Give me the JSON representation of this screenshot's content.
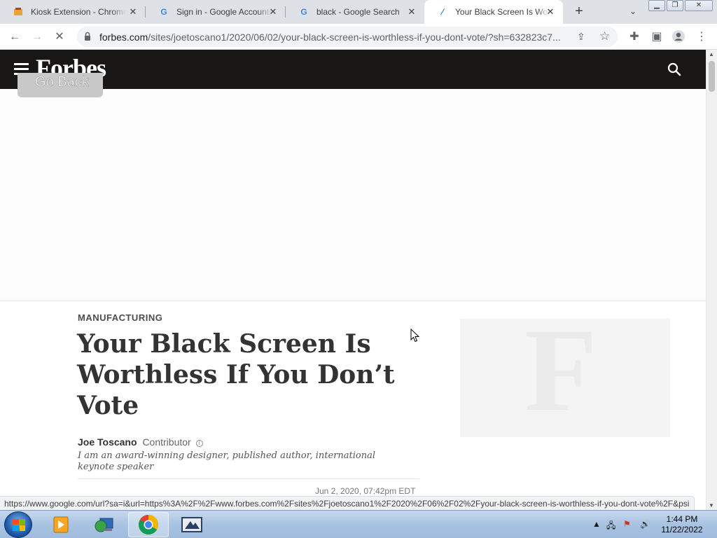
{
  "browser": {
    "tabs": [
      {
        "title": "Kiosk Extension - Chrome",
        "favicon": "kiosk-favicon",
        "active": false
      },
      {
        "title": "Sign in - Google Accounts",
        "favicon": "google-favicon",
        "active": false
      },
      {
        "title": "black - Google Search",
        "favicon": "google-favicon",
        "active": false
      },
      {
        "title": "Your Black Screen Is Worthless",
        "favicon": "forbes-favicon",
        "active": true
      }
    ],
    "new_tab_symbol": "+",
    "url_host": "forbes.com",
    "url_path": "/sites/joetoscano1/2020/06/02/your-black-screen-is-worthless-if-you-dont-vote/?sh=632823c7...",
    "status_url": "https://www.google.com/url?sa=i&url=https%3A%2F%2Fwww.forbes.com%2Fsites%2Fjoetoscano1%2F2020%2F06%2F02%2Fyour-black-screen-is-worthless-if-you-dont-vote%2F&psi..."
  },
  "page": {
    "logo": "Forbes",
    "go_back": "Go Back",
    "category": "MANUFACTURING",
    "headline": "Your Black Screen Is Worthless If You Don’t Vote",
    "author_name": "Joe Toscano",
    "author_role": "Contributor",
    "bio": "I am an award-winning designer, published author, international keynote speaker",
    "date": "Jun 2, 2020, 07:42pm EDT",
    "placeholder_letter": "F"
  },
  "taskbar": {
    "apps": [
      "media-player",
      "network-app",
      "chrome",
      "remote-desktop"
    ],
    "time": "1:44 PM",
    "date": "11/22/2022"
  },
  "colors": {
    "forbes_header": "#181716",
    "tabstrip": "#dee1e6",
    "taskbar": "#a9c3e2"
  }
}
